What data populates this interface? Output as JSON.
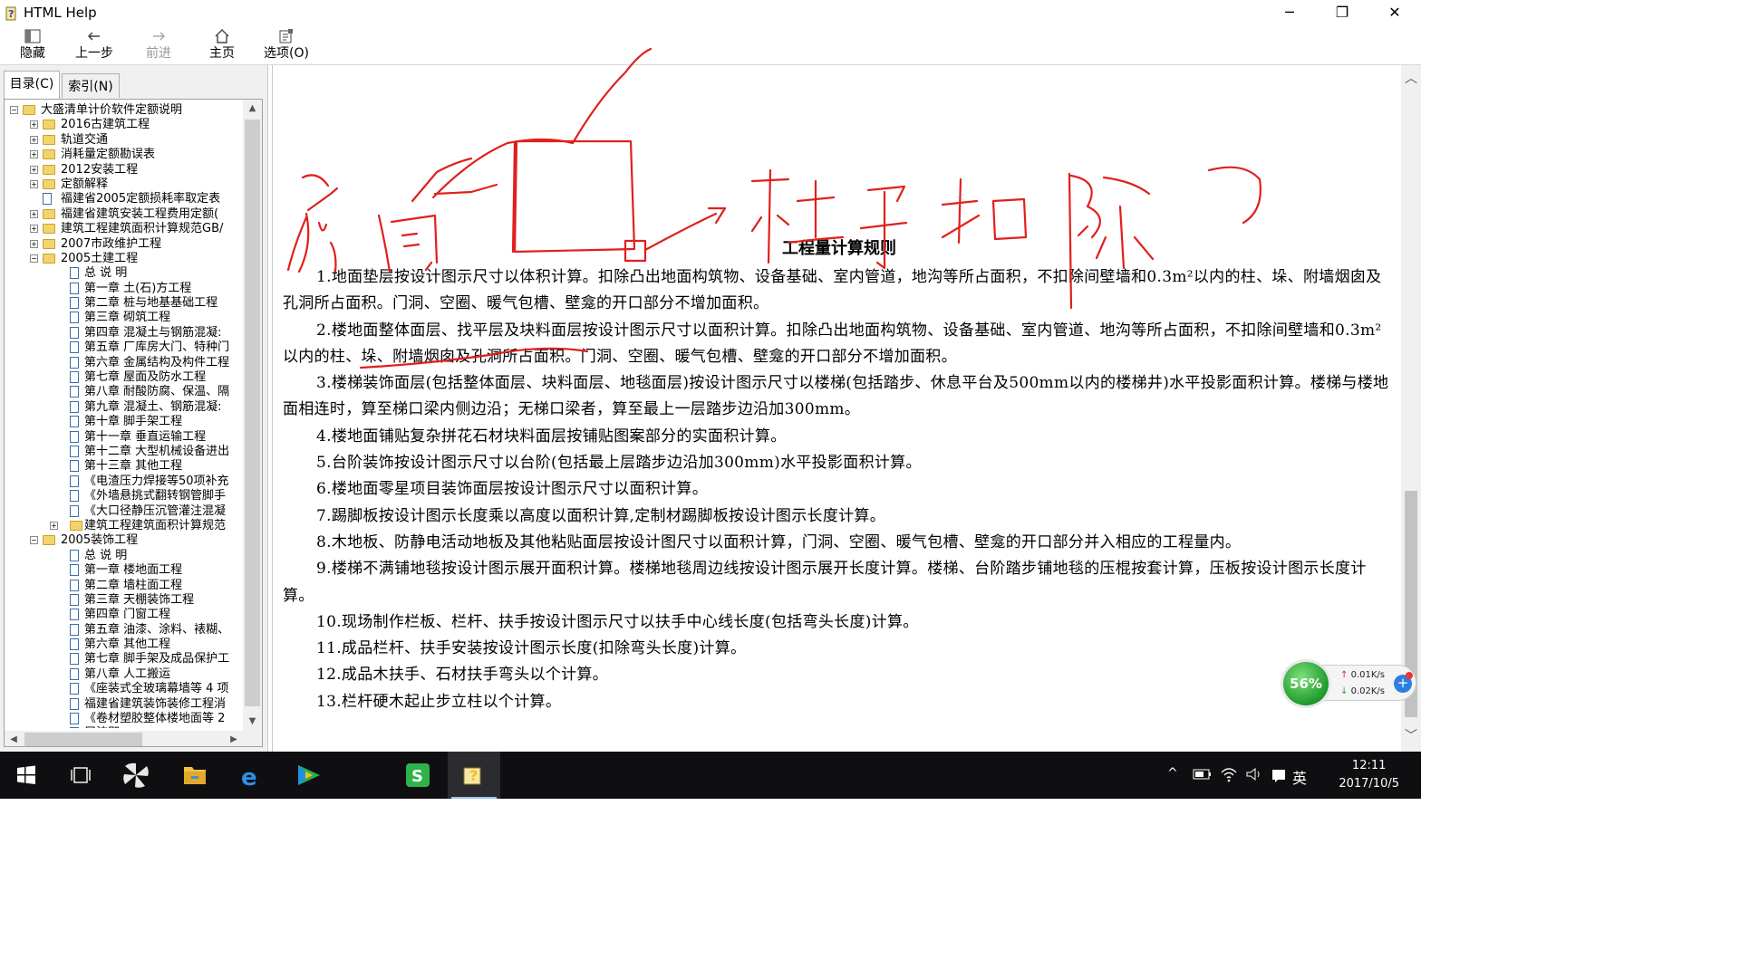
{
  "window": {
    "title": "HTML Help",
    "icon": "help-book-icon",
    "minimize": "─",
    "restore": "❐",
    "close": "✕"
  },
  "toolbar": [
    {
      "label": "隐藏",
      "icon": "hide-pane-icon",
      "enabled": true
    },
    {
      "label": "上一步",
      "icon": "back-arrow-icon",
      "enabled": true
    },
    {
      "label": "前进",
      "icon": "forward-arrow-icon",
      "enabled": false
    },
    {
      "label": "主页",
      "icon": "home-icon",
      "enabled": true
    },
    {
      "label": "选项(O)",
      "icon": "options-icon",
      "enabled": true
    }
  ],
  "tabs": {
    "toc": "目录(C)",
    "index": "索引(N)"
  },
  "tree": [
    {
      "label": "大盛清单计价软件定额说明",
      "kind": "folder",
      "level": 0,
      "expander": "−"
    },
    {
      "label": "2016古建筑工程",
      "kind": "folder",
      "level": 1,
      "expander": "+"
    },
    {
      "label": "轨道交通",
      "kind": "folder",
      "level": 1,
      "expander": "+"
    },
    {
      "label": "消耗量定额勘误表",
      "kind": "folder",
      "level": 1,
      "expander": "+"
    },
    {
      "label": "2012安装工程",
      "kind": "folder",
      "level": 1,
      "expander": "+"
    },
    {
      "label": "定额解释",
      "kind": "folder",
      "level": 1,
      "expander": "+"
    },
    {
      "label": "福建省2005定额损耗率取定表",
      "kind": "page",
      "level": 1,
      "expander": ""
    },
    {
      "label": "福建省建筑安装工程费用定额(",
      "kind": "folder",
      "level": 1,
      "expander": "+"
    },
    {
      "label": "建筑工程建筑面积计算规范GB/",
      "kind": "folder",
      "level": 1,
      "expander": "+"
    },
    {
      "label": "2007市政维护工程",
      "kind": "folder",
      "level": 1,
      "expander": "+"
    },
    {
      "label": "2005土建工程",
      "kind": "folder",
      "level": 1,
      "expander": "−"
    },
    {
      "label": "总 说 明",
      "kind": "page",
      "level": 2,
      "expander": ""
    },
    {
      "label": "第一章 土(石)方工程",
      "kind": "page",
      "level": 2,
      "expander": ""
    },
    {
      "label": "第二章 桩与地基基础工程",
      "kind": "page",
      "level": 2,
      "expander": ""
    },
    {
      "label": "第三章 砌筑工程",
      "kind": "page",
      "level": 2,
      "expander": ""
    },
    {
      "label": "第四章 混凝土与钢筋混凝:",
      "kind": "page",
      "level": 2,
      "expander": ""
    },
    {
      "label": "第五章 厂库房大门、特种门",
      "kind": "page",
      "level": 2,
      "expander": ""
    },
    {
      "label": "第六章 金属结构及构件工程",
      "kind": "page",
      "level": 2,
      "expander": ""
    },
    {
      "label": "第七章 屋面及防水工程",
      "kind": "page",
      "level": 2,
      "expander": ""
    },
    {
      "label": "第八章 耐酸防腐、保温、隔",
      "kind": "page",
      "level": 2,
      "expander": ""
    },
    {
      "label": "第九章 混凝土、钢筋混凝:",
      "kind": "page",
      "level": 2,
      "expander": ""
    },
    {
      "label": "第十章 脚手架工程",
      "kind": "page",
      "level": 2,
      "expander": ""
    },
    {
      "label": "第十一章 垂直运输工程",
      "kind": "page",
      "level": 2,
      "expander": ""
    },
    {
      "label": "第十二章 大型机械设备进出",
      "kind": "page",
      "level": 2,
      "expander": ""
    },
    {
      "label": "第十三章 其他工程",
      "kind": "page",
      "level": 2,
      "expander": ""
    },
    {
      "label": "《电渣压力焊接等50项补充",
      "kind": "page",
      "level": 2,
      "expander": ""
    },
    {
      "label": "《外墙悬挑式翻转钢管脚手",
      "kind": "page",
      "level": 2,
      "expander": ""
    },
    {
      "label": "《大口径静压沉管灌注混凝",
      "kind": "page",
      "level": 2,
      "expander": ""
    },
    {
      "label": "建筑工程建筑面积计算规范",
      "kind": "folder",
      "level": 2,
      "expander": "+"
    },
    {
      "label": "2005装饰工程",
      "kind": "folder",
      "level": 1,
      "expander": "−"
    },
    {
      "label": "总 说 明",
      "kind": "page",
      "level": 2,
      "expander": ""
    },
    {
      "label": "第一章 楼地面工程",
      "kind": "page",
      "level": 2,
      "expander": ""
    },
    {
      "label": "第二章 墙柱面工程",
      "kind": "page",
      "level": 2,
      "expander": ""
    },
    {
      "label": "第三章 天棚装饰工程",
      "kind": "page",
      "level": 2,
      "expander": ""
    },
    {
      "label": "第四章 门窗工程",
      "kind": "page",
      "level": 2,
      "expander": ""
    },
    {
      "label": "第五章 油漆、涂料、裱糊、",
      "kind": "page",
      "level": 2,
      "expander": ""
    },
    {
      "label": "第六章 其他工程",
      "kind": "page",
      "level": 2,
      "expander": ""
    },
    {
      "label": "第七章 脚手架及成品保护工",
      "kind": "page",
      "level": 2,
      "expander": ""
    },
    {
      "label": "第八章 人工搬运",
      "kind": "page",
      "level": 2,
      "expander": ""
    },
    {
      "label": "《座装式全玻璃幕墙等 4 项",
      "kind": "page",
      "level": 2,
      "expander": ""
    },
    {
      "label": "福建省建筑装饰装修工程消",
      "kind": "page",
      "level": 2,
      "expander": ""
    },
    {
      "label": "《卷材塑胶整体楼地面等 2",
      "kind": "page",
      "level": 2,
      "expander": ""
    },
    {
      "label": "屋波即",
      "kind": "page",
      "level": 2,
      "expander": ""
    }
  ],
  "doc": {
    "title": "工程量计算规则",
    "paragraphs": [
      "1.地面垫层按设计图示尺寸以体积计算。扣除凸出地面构筑物、设备基础、室内管道，地沟等所占面积，不扣除间壁墙和0.3m²以内的柱、垛、附墙烟囱及孔洞所占面积。门洞、空圈、暖气包槽、壁龛的开口部分不增加面积。",
      "2.楼地面整体面层、找平层及块料面层按设计图示尺寸以面积计算。扣除凸出地面构筑物、设备基础、室内管道、地沟等所占面积，不扣除间壁墙和0.3m²以内的柱、垛、附墙烟囱及孔洞所占面积。门洞、空圈、暖气包槽、壁龛的开口部分不增加面积。",
      "3.楼梯装饰面层(包括整体面层、块料面层、地毯面层)按设计图示尺寸以楼梯(包括踏步、休息平台及500mm以内的楼梯井)水平投影面积计算。楼梯与楼地面相连时，算至梯口梁内侧边沿；无梯口梁者，算至最上一层踏步边沿加300mm。",
      "4.楼地面铺贴复杂拼花石材块料面层按铺贴图案部分的实面积计算。",
      "5.台阶装饰按设计图示尺寸以台阶(包括最上层踏步边沿加300mm)水平投影面积计算。",
      "6.楼地面零星项目装饰面层按设计图示尺寸以面积计算。",
      "7.踢脚板按设计图示长度乘以高度以面积计算,定制材踢脚板按设计图示长度计算。",
      "8.木地板、防静电活动地板及其他粘贴面层按设计图尺寸以面积计算，门洞、空圈、暖气包槽、壁龛的开口部分并入相应的工程量内。",
      "9.楼梯不满铺地毯按设计图示展开面积计算。楼梯地毯周边线按设计图示展开长度计算。楼梯、台阶踏步铺地毯的压棍按套计算，压板按设计图示长度计算。",
      "10.现场制作栏板、栏杆、扶手按设计图示尺寸以扶手中心线长度(包括弯头长度)计算。",
      "11.成品栏杆、扶手安装按设计图示长度(扣除弯头长度)计算。",
      "12.成品木扶手、石材扶手弯头以个计算。",
      "13.栏杆硬木起止步立柱以个计算。"
    ]
  },
  "annotation": {
    "color": "#e0201c",
    "note": "handwritten red ink: 房间 → 柱子 扣除?"
  },
  "net_widget": {
    "percent": "56%",
    "upload": "0.01K/s",
    "download": "0.02K/s",
    "add": "+"
  },
  "taskbar": {
    "apps": [
      "start-icon",
      "task-view-icon",
      "pinwheel-app-icon",
      "file-explorer-icon",
      "edge-browser-icon",
      "media-player-icon",
      "green-s-app-icon",
      "html-help-app-icon"
    ],
    "tray": {
      "chevron": "^",
      "ime": "英",
      "time": "12:11",
      "date": "2017/10/5"
    }
  }
}
